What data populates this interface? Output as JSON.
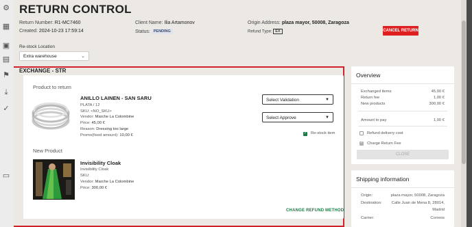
{
  "header": {
    "title": "RETURN CONTROL",
    "return_number_label": "Return Number:",
    "return_number": "R1-MC7460",
    "created_label": "Created:",
    "created": "2024-10-23 17:59:14",
    "client_name_label": "Client Name:",
    "client_name": "Ilia Artamonov",
    "status_label": "Status:",
    "status": "PENDING",
    "origin_label": "Origin Address:",
    "origin": "plaza mayor, 50008, Zaragoza",
    "refund_type_label": "Refund Type:",
    "refund_type": "EX",
    "cancel_label": "CANCEL RETURN"
  },
  "restock": {
    "label": "Re-stock Location",
    "value": "Extra warehouse"
  },
  "exchange": {
    "title": "EXCHANGE - STR",
    "product_to_return_heading": "Product to return",
    "returned_product": {
      "name": "ANILLO LAINEN - SAN SARU",
      "variant": "PLATA / 12",
      "sku": "SKU: <NO_SKU>",
      "vendor_label": "Vendor:",
      "vendor": "Marche La Colombine",
      "price_label": "Price:",
      "price": "45,00 €",
      "reason_label": "Reason:",
      "reason": "Dressing too large",
      "promo_label": "Promo(fixed amount):",
      "promo": "10,00 €"
    },
    "select_validation": "Select Validation",
    "select_approve": "Select Approve",
    "restock_item_label": "Re-stock item",
    "new_product_heading": "New Product",
    "new_product": {
      "name": "Invisibility Cloak",
      "variant": "Invisibility Cloak",
      "sku": "SKU:",
      "vendor_label": "Vendor:",
      "vendor": "Marche La Colombine",
      "price_label": "Price:",
      "price": "300,00 €"
    },
    "change_refund_label": "CHANGE REFUND METHOD"
  },
  "overview": {
    "title": "Overview",
    "exchanged_items_label": "Exchanged items",
    "exchanged_items": "45,00 €",
    "return_fee_label": "Return fee",
    "return_fee": "1,00 €",
    "new_products_label": "New products",
    "new_products": "300,00 €",
    "amount_to_pay_label": "Amount to pay",
    "amount_to_pay": "1,00 €",
    "refund_delivery_label": "Refund delivery cost",
    "charge_fee_label": "Charge Return Fee",
    "close_label": "CLOSE"
  },
  "shipping": {
    "title": "Shipping information",
    "origin_label": "Origin:",
    "origin": "plaza mayor, 50008, Zaragoza",
    "destination_label": "Destination:",
    "destination_line1": "Calle Juan de Mena 8, 28014,",
    "destination_line2": "Madrid",
    "carrier_label": "Carrier:",
    "carrier": "Correos"
  },
  "colors": {
    "accent_green": "#1b7a45",
    "danger_red": "#e02020",
    "highlight_red": "#d2202a"
  }
}
